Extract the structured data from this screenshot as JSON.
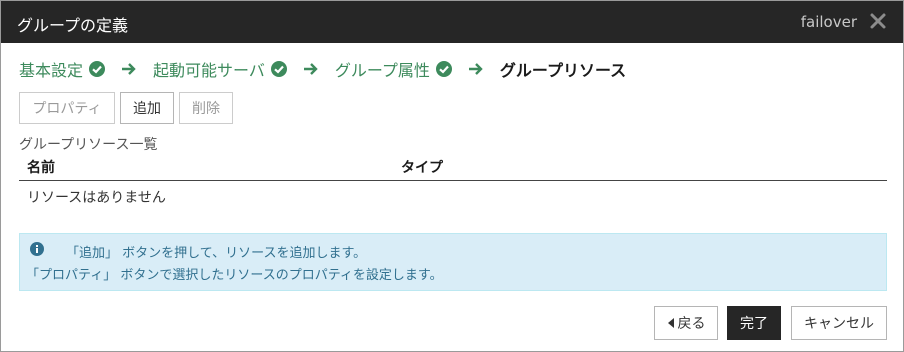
{
  "dialog": {
    "title": "グループの定義",
    "host": "failover",
    "close_icon": "close-icon"
  },
  "wizard": {
    "steps": [
      {
        "label": "基本設定",
        "status": "done"
      },
      {
        "label": "起動可能サーバ",
        "status": "done"
      },
      {
        "label": "グループ属性",
        "status": "done"
      },
      {
        "label": "グループリソース",
        "status": "current"
      }
    ],
    "colors": {
      "done": "#3d8a5c",
      "current": "#1a1a1a"
    }
  },
  "toolbar": {
    "properties_label": "プロパティ",
    "add_label": "追加",
    "delete_label": "削除"
  },
  "resource_list": {
    "caption": "グループリソース一覧",
    "columns": [
      "名前",
      "タイプ"
    ],
    "empty_text": "リソースはありません"
  },
  "info": {
    "icon": "info-icon",
    "line1": "「追加」 ボタンを押して、リソースを追加します。",
    "line2": "「プロパティ」 ボタンで選択したリソースのプロパティを設定します。",
    "background": "#d9edf7"
  },
  "footer": {
    "back_label": "戻る",
    "finish_label": "完了",
    "cancel_label": "キャンセル"
  }
}
